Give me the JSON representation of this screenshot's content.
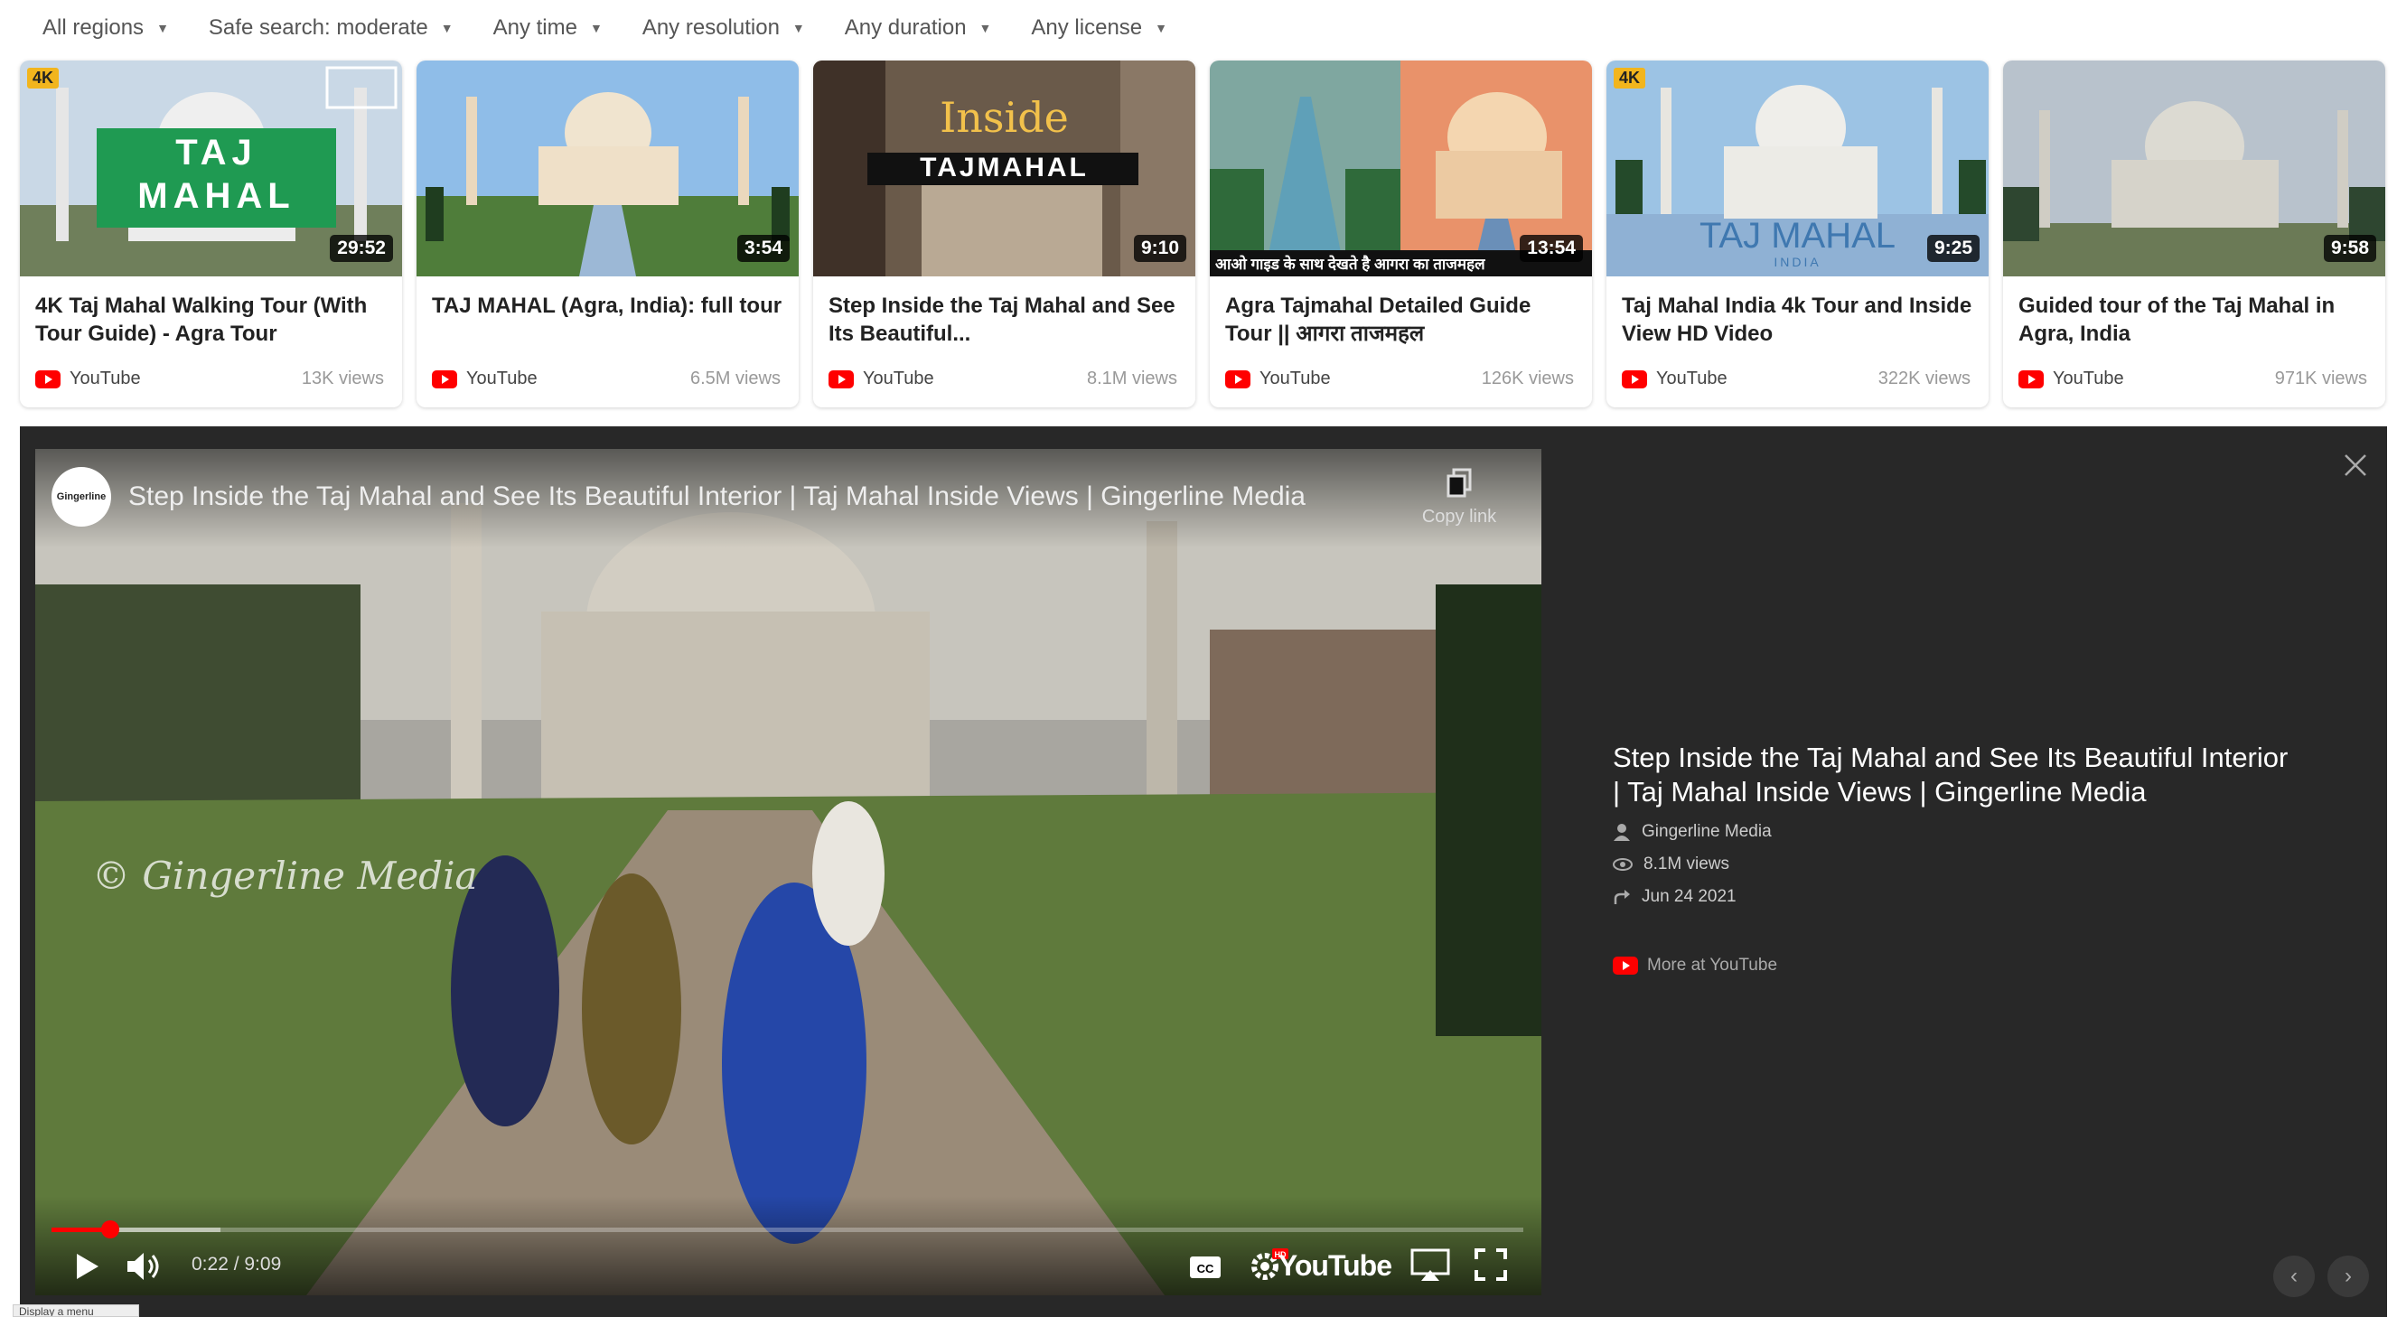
{
  "filters": [
    {
      "label": "All regions"
    },
    {
      "label": "Safe search: moderate"
    },
    {
      "label": "Any time"
    },
    {
      "label": "Any resolution"
    },
    {
      "label": "Any duration"
    },
    {
      "label": "Any license"
    }
  ],
  "results": [
    {
      "title": "4K Taj Mahal Walking Tour (With Tour Guide) - Agra Tour",
      "duration": "29:52",
      "source": "YouTube",
      "views": "13K views",
      "badge": "4K",
      "thumb_text": "TAJ MAHAL"
    },
    {
      "title": "TAJ MAHAL (Agra, India): full tour",
      "duration": "3:54",
      "source": "YouTube",
      "views": "6.5M views"
    },
    {
      "title": "Step Inside the Taj Mahal and See Its Beautiful...",
      "duration": "9:10",
      "source": "YouTube",
      "views": "8.1M views",
      "thumb_text_1": "Inside",
      "thumb_text_2": "TAJMAHAL"
    },
    {
      "title": "Agra Tajmahal Detailed Guide Tour || आगरा ताजमहल",
      "duration": "13:54",
      "source": "YouTube",
      "views": "126K views",
      "thumb_caption": "आओ गाइड के साथ देखते है आगरा का ताजमहल"
    },
    {
      "title": "Taj Mahal India 4k Tour and Inside View HD Video",
      "duration": "9:25",
      "source": "YouTube",
      "views": "322K views",
      "badge": "4K",
      "thumb_text": "TAJ MAHAL",
      "thumb_sub": "INDIA"
    },
    {
      "title": "Guided tour of the Taj Mahal in Agra, India",
      "duration": "9:58",
      "source": "YouTube",
      "views": "971K views"
    }
  ],
  "player": {
    "title": "Step Inside the Taj Mahal and See Its Beautiful Interior | Taj Mahal Inside Views | Gingerline Media",
    "copy_link": "Copy link",
    "watermark": "© Gingerline Media",
    "avatar_text": "Gingerline",
    "time": "0:22 / 9:09",
    "progress": 0.04,
    "buffered": 0.115,
    "brand": "YouTube"
  },
  "info": {
    "title": "Step Inside the Taj Mahal and See Its Beautiful Interior | Taj Mahal Inside Views | Gingerline Media",
    "channel": "Gingerline Media",
    "views": "8.1M views",
    "date": "Jun 24 2021",
    "more": "More at YouTube"
  },
  "tooltip": "Display a menu",
  "colors": {
    "youtube_red": "#ff0000",
    "panel_bg": "#282828"
  }
}
